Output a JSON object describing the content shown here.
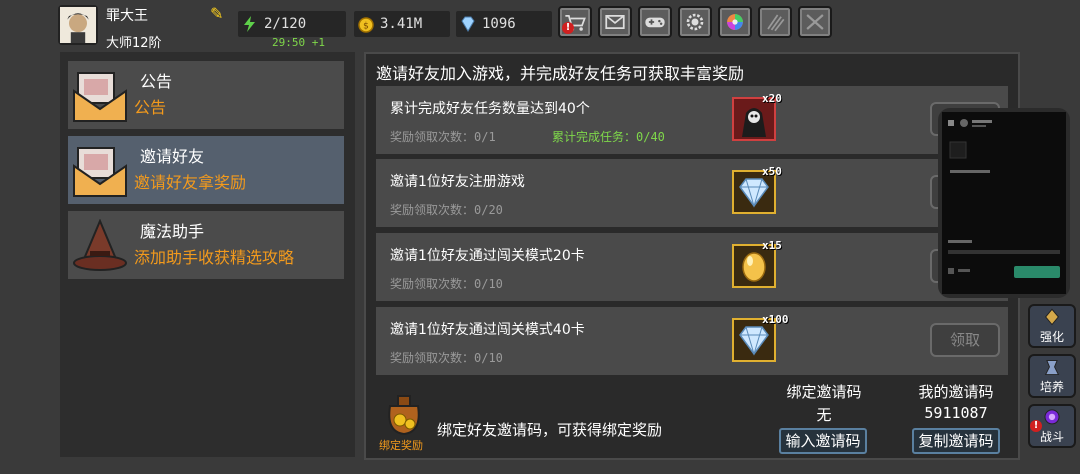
{
  "player": {
    "name": "罪大王",
    "rank": "大师12阶",
    "stamina": "2/120",
    "stamina_timer": "29:50 +1",
    "coins": "3.41M",
    "gems": "1096"
  },
  "toolbar": {
    "icons": [
      "shop-cart-icon",
      "mail-icon",
      "gamepad-icon",
      "gear-icon",
      "color-wheel-icon",
      "claw-icon",
      "crossed-swords-icon"
    ]
  },
  "sidebar": {
    "items": [
      {
        "title": "公告",
        "subtitle": "公告"
      },
      {
        "title": "邀请好友",
        "subtitle": "邀请好友拿奖励"
      },
      {
        "title": "魔法助手",
        "subtitle": "添加助手收获精选攻略"
      }
    ]
  },
  "main": {
    "header": "邀请好友加入游戏，并完成好友任务可获取丰富奖励",
    "tasks": [
      {
        "title": "累计完成好友任务数量达到40个",
        "claims": "奖励领取次数：0/1",
        "progress": "累计完成任务：0/40",
        "reward_qty": "x20",
        "reward_icon": "reaper-icon"
      },
      {
        "title": "邀请1位好友注册游戏",
        "claims": "奖励领取次数：0/20",
        "reward_qty": "x50",
        "reward_icon": "diamond-icon"
      },
      {
        "title": "邀请1位好友通过闯关模式20卡",
        "claims": "奖励领取次数：0/10",
        "reward_qty": "x15",
        "reward_icon": "golden-egg-icon"
      },
      {
        "title": "邀请1位好友通过闯关模式40卡",
        "claims": "奖励领取次数：0/10",
        "reward_qty": "x100",
        "reward_icon": "diamond-icon"
      }
    ],
    "claim_label": "领取",
    "bind_text": "绑定好友邀请码，可获得绑定奖励",
    "bind_tag": "绑定奖励",
    "bound_code_label": "绑定邀请码",
    "bound_code_value": "无",
    "my_code_label": "我的邀请码",
    "my_code_value": "5911087",
    "enter_code_button": "输入邀请码",
    "copy_code_button": "复制邀请码"
  },
  "side_nav": {
    "upgrade": "强化",
    "cultivate": "培养",
    "battle": "战斗"
  },
  "colors": {
    "accent_orange": "#f39a1c",
    "progress_green": "#7fd84a",
    "panel_bg": "#2a2a2a",
    "active_item": "#55606e"
  }
}
